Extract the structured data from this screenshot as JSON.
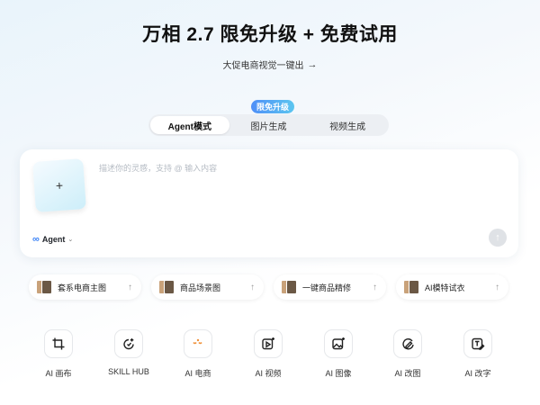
{
  "hero": {
    "title": "万相 2.7 限免升级 + 免费试用",
    "subtitle": "大促电商视觉一键出",
    "subtitle_arrow": "→"
  },
  "tabs": [
    {
      "label": "Agent模式",
      "active": true
    },
    {
      "label": "图片生成",
      "active": false
    },
    {
      "label": "视频生成",
      "active": false
    }
  ],
  "promo_badge": "限免升级",
  "composer": {
    "upload_symbol": "+",
    "placeholder": "描述你的灵感，支持 @ 输入内容",
    "value": "",
    "agent_symbol": "∞",
    "agent_label": "Agent",
    "agent_chevron": "⌄",
    "send_symbol": "↑"
  },
  "chips": [
    {
      "label": "套系电商主图",
      "arrow": "↑"
    },
    {
      "label": "商品场景图",
      "arrow": "↑"
    },
    {
      "label": "一键商品精修",
      "arrow": "↑"
    },
    {
      "label": "AI模特试衣",
      "arrow": "↑"
    }
  ],
  "tools": [
    {
      "label": "AI 画布",
      "icon": "crop-icon"
    },
    {
      "label": "SKILL HUB",
      "icon": "skill-icon"
    },
    {
      "label": "AI 电商",
      "icon": "shop-icon"
    },
    {
      "label": "AI 视频",
      "icon": "video-icon"
    },
    {
      "label": "AI 图像",
      "icon": "image-icon"
    },
    {
      "label": "AI 改图",
      "icon": "edit-image-icon"
    },
    {
      "label": "AI 改字",
      "icon": "edit-text-icon"
    }
  ],
  "colors": {
    "accent": "#3a82f6",
    "badge_start": "#4f8ff7",
    "badge_end": "#5cc6f0",
    "send_disabled": "#dfe2e6"
  }
}
